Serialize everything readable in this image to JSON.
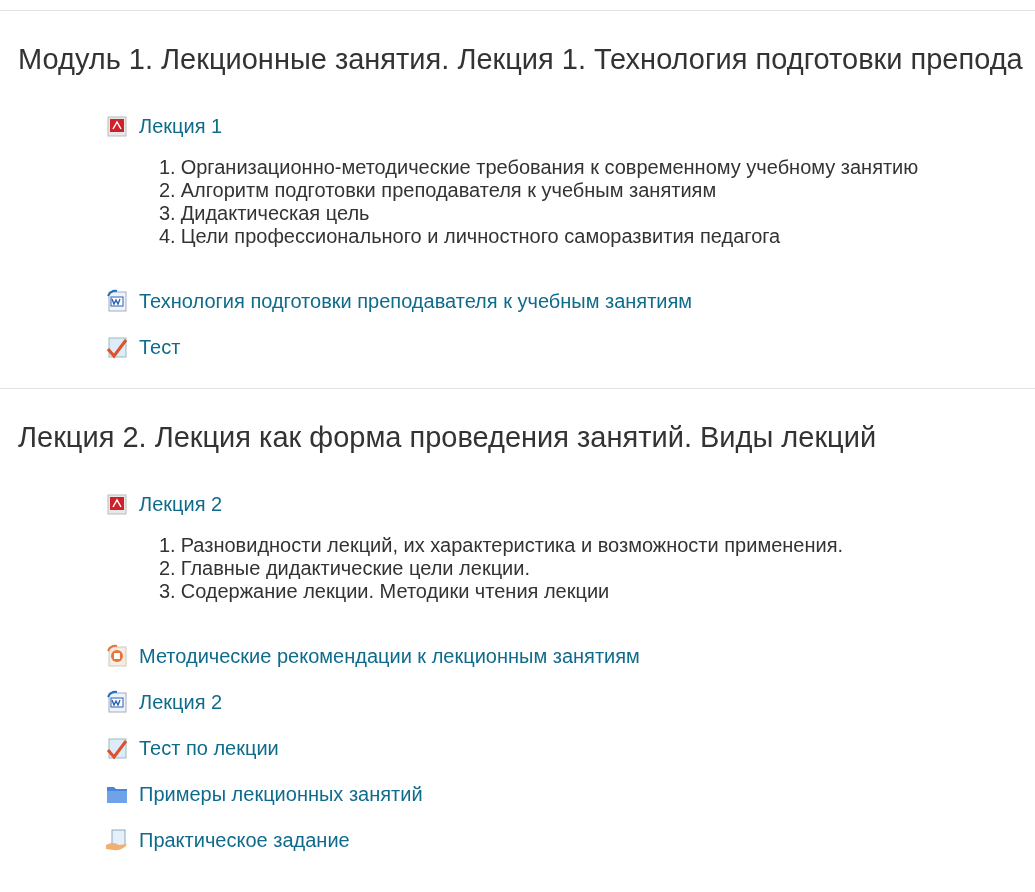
{
  "sections": [
    {
      "title": "Модуль 1. Лекционные занятия. Лекция 1. Технология подготовки препода",
      "activities": [
        {
          "kind": "pdf",
          "name": "Лекция 1",
          "items": [
            {
              "number": "1.",
              "text": "Организационно-методические требования к современному учебному занятию"
            },
            {
              "number": "2.",
              "text": "Алгоритм подготовки преподавателя к учебным занятиям"
            },
            {
              "number": "3.",
              "text": "Дидактическая цель"
            },
            {
              "number": "4.",
              "text": "Цели профессионального и личностного саморазвития педагога"
            }
          ]
        },
        {
          "kind": "word",
          "name": "Технология подготовки преподавателя к учебным занятиям"
        },
        {
          "kind": "quiz",
          "name": "Тест"
        }
      ]
    },
    {
      "title": "Лекция 2. Лекция как форма проведения занятий. Виды лекций",
      "activities": [
        {
          "kind": "pdf",
          "name": "Лекция 2",
          "items": [
            {
              "number": "1.",
              "text": "Разновидности лекций, их характеристика и возможности применения."
            },
            {
              "number": "2.",
              "text": "Главные дидактические цели лекции."
            },
            {
              "number": "3.",
              "text": "Содержание лекции. Методики чтения лекции"
            }
          ]
        },
        {
          "kind": "ppt",
          "name": "Методические рекомендации к лекционным занятиям"
        },
        {
          "kind": "word",
          "name": "Лекция 2"
        },
        {
          "kind": "quiz",
          "name": "Тест по лекции"
        },
        {
          "kind": "folder",
          "name": "Примеры лекционных занятий"
        },
        {
          "kind": "assign",
          "name": "Практическое задание"
        }
      ]
    }
  ]
}
